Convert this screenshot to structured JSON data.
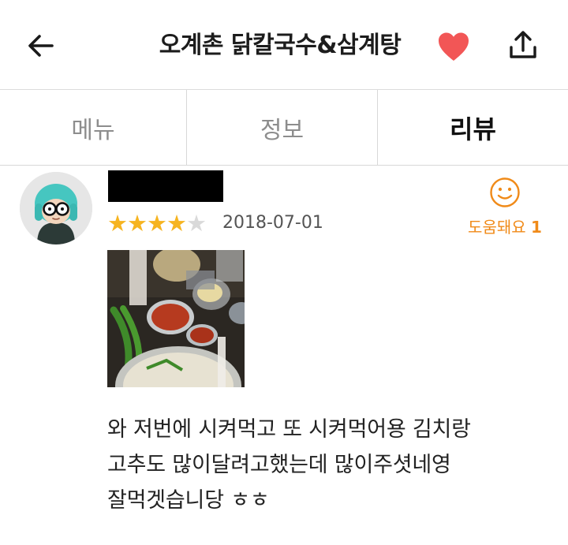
{
  "header": {
    "title": "오계촌 닭칼국수&삼계탕",
    "back_icon": "arrow-left-icon",
    "favorite_icon": "heart-icon",
    "share_icon": "share-icon",
    "favorite_color": "#f25656"
  },
  "tabs": [
    {
      "label": "메뉴",
      "active": false
    },
    {
      "label": "정보",
      "active": false
    },
    {
      "label": "리뷰",
      "active": true
    }
  ],
  "review": {
    "author_name_hidden": true,
    "rating": 4,
    "rating_max": 5,
    "date": "2018-07-01",
    "helpful": {
      "label": "도움돼요",
      "count": "1",
      "icon": "smile-icon",
      "color": "#f08a18"
    },
    "text_lines": [
      "와 저번에 시켜먹고 또 시켜먹어용 김치랑",
      "고추도 많이달려고했는데 많이주셧네영",
      "잘먹겟습니당 ㅎㅎ"
    ]
  },
  "colors": {
    "star_filled": "#f6b420",
    "star_empty": "#d9d9d9",
    "divider": "#d8d8d8"
  }
}
